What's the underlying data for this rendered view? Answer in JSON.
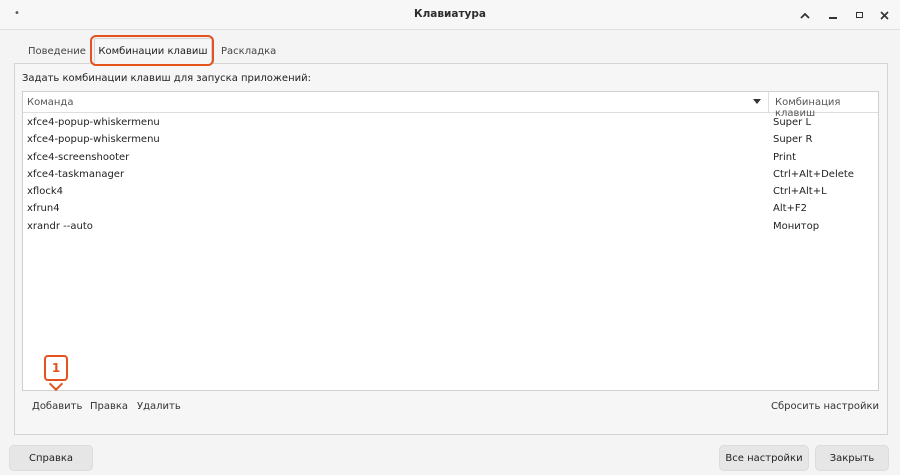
{
  "window": {
    "title": "Клавиатура",
    "menu_icon": "•",
    "controls": {
      "up": "^",
      "minimize": "–",
      "maximize": "□",
      "close": "×"
    }
  },
  "tabs": [
    {
      "label": "Поведение",
      "active": false
    },
    {
      "label": "Комбинации клавиш",
      "active": true
    },
    {
      "label": "Раскладка",
      "active": false
    }
  ],
  "shortcuts": {
    "description": "Задать комбинации клавиш для запуска приложений:",
    "columns": {
      "command": "Команда",
      "shortcut": "Комбинация клавиш"
    },
    "rows": [
      {
        "command": "xfce4-popup-whiskermenu",
        "shortcut": "Super L"
      },
      {
        "command": "xfce4-popup-whiskermenu",
        "shortcut": "Super R"
      },
      {
        "command": "xfce4-screenshooter",
        "shortcut": "Print"
      },
      {
        "command": "xfce4-taskmanager",
        "shortcut": "Ctrl+Alt+Delete"
      },
      {
        "command": "xflock4",
        "shortcut": "Ctrl+Alt+L"
      },
      {
        "command": "xfrun4",
        "shortcut": "Alt+F2"
      },
      {
        "command": "xrandr --auto",
        "shortcut": "Монитор"
      }
    ],
    "toolbar": {
      "add": "Добавить",
      "edit": "Правка",
      "delete": "Удалить",
      "reset": "Сбросить настройки"
    }
  },
  "callout": {
    "number": "1"
  },
  "accent_color": "#e2531e",
  "buttons": {
    "help": "Справка",
    "all_settings": "Все настройки",
    "close": "Закрыть"
  }
}
